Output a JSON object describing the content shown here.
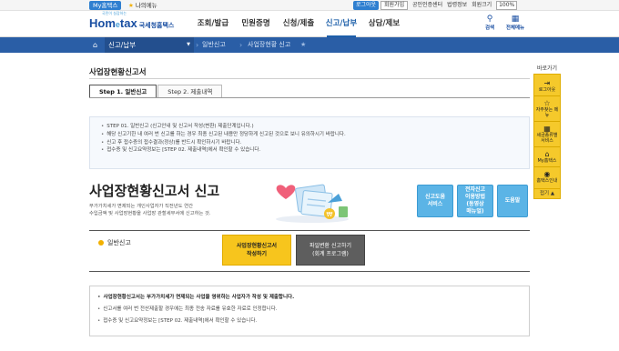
{
  "topbar": {
    "my_tab": "My홈택스",
    "my_menu": "나의메뉴",
    "login": "로그아웃",
    "signup": "회원가입",
    "links": [
      "공인인증센터",
      "법령정보",
      "회원크기"
    ],
    "zoom": "100%"
  },
  "header": {
    "logo_main": "Hom",
    "logo_e": "e",
    "logo_tax": "tax",
    "logo_sub": "국세청홈택스",
    "slogan": "국민이 실감하는",
    "nav": [
      "조회/발급",
      "민원증명",
      "신청/제출",
      "신고/납부",
      "상담/제보"
    ],
    "nav_active_index": 3,
    "search_label": "검색",
    "allmenu_label": "전체메뉴"
  },
  "breadcrumb": {
    "main": "신고/납부",
    "sub1": "일반신고",
    "sub2": "사업장현황 신고"
  },
  "page": {
    "title": "사업장현황신고서",
    "tabs": [
      "Step 1. 일반신고",
      "Step 2. 제출내역"
    ]
  },
  "notice": {
    "items": [
      "STEP 01. 일반신고 (신고안내 및 신고서 작성(변환) 제출단계입니다.)",
      "해당 신고기한 내 여러 번 신고를 하는 경우 최종 신고된 내용만 정당하게 신고된 것으로 보니 유의하시기 바랍니다.",
      "신고 후 접수증의 접수결과(정상)를 반드시 확인하시기 바랍니다.",
      "접수증 및 신고요약정보는 [STEP 02. 제출내역]에서 확인할 수 있습니다."
    ]
  },
  "banner": {
    "title": "사업장현황신고서 신고",
    "desc1": "부가가치세가 면제되는 개인사업자가 직전년도 연간",
    "desc2": "수입금액 및 사업장현황을 사업장 관할세무서에 신고하는 것.",
    "btn_guide": [
      "신고도움",
      "서비스"
    ],
    "btn_video": [
      "전자신고",
      "이용방법",
      "(동영상",
      "매뉴얼)"
    ],
    "btn_help": "도움말"
  },
  "filing": {
    "label": "일반신고",
    "write_btn": [
      "사업장현황신고서",
      "작성하기"
    ],
    "change_btn": [
      "파일변환 신고하기",
      "(회계 프로그램)"
    ]
  },
  "notes": {
    "items": [
      "사업장현황신고서는 부가가치세가 면제되는 사업을 영위하는 사업자가 작성 및 제출합니다.",
      "신고서를 여러 번 전산제출할 경우에는 최종 전송 자료를 유효한 자료로 인정합니다.",
      "접수증 및 신고요약정보는 [STEP 02. 제출내역]에서 확인할 수 있습니다."
    ]
  },
  "quick": {
    "title": "바로가기",
    "items": [
      "로그아웃",
      "자주찾는 메뉴",
      "세금종류별 서비스",
      "My홈택스",
      "홈택스인내"
    ],
    "close": "접기"
  }
}
